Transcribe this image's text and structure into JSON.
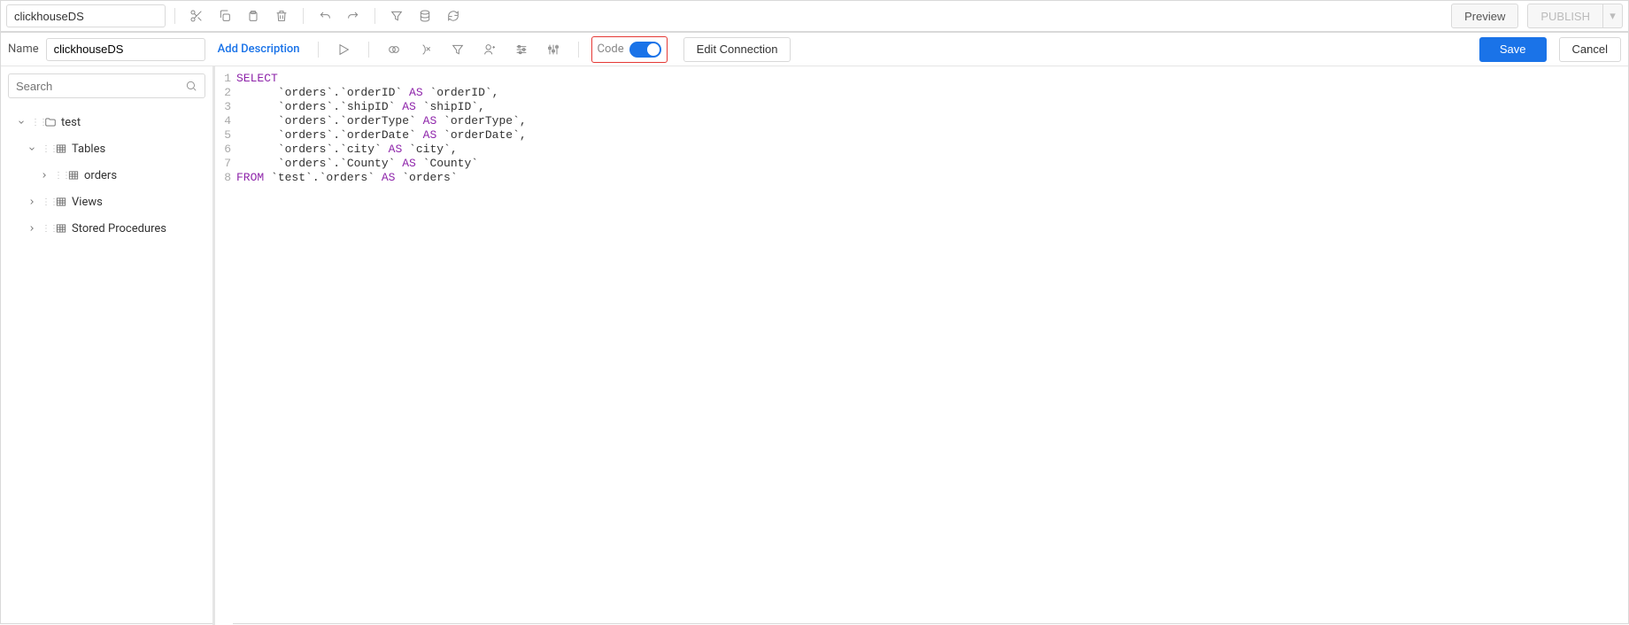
{
  "topToolbar": {
    "dataSourceName": "clickhouseDS",
    "previewLabel": "Preview",
    "publishLabel": "PUBLISH"
  },
  "secondToolbar": {
    "nameLabel": "Name",
    "nameValue": "clickhouseDS",
    "addDescription": "Add Description",
    "codeLabel": "Code",
    "editConnectionLabel": "Edit Connection",
    "saveLabel": "Save",
    "cancelLabel": "Cancel"
  },
  "sidebar": {
    "searchPlaceholder": "Search",
    "nodes": {
      "test": "test",
      "tables": "Tables",
      "orders": "orders",
      "views": "Views",
      "storedProcedures": "Stored Procedures"
    }
  },
  "editor": {
    "lineNumbers": [
      "1",
      "2",
      "3",
      "4",
      "5",
      "6",
      "7",
      "8"
    ],
    "lines": [
      [
        {
          "t": "SELECT",
          "c": "kw"
        }
      ],
      [
        {
          "t": "      `orders`.`orderID` ",
          "c": "id"
        },
        {
          "t": "AS",
          "c": "kw"
        },
        {
          "t": " `orderID`,",
          "c": "id"
        }
      ],
      [
        {
          "t": "      `orders`.`shipID` ",
          "c": "id"
        },
        {
          "t": "AS",
          "c": "kw"
        },
        {
          "t": " `shipID`,",
          "c": "id"
        }
      ],
      [
        {
          "t": "      `orders`.`orderType` ",
          "c": "id"
        },
        {
          "t": "AS",
          "c": "kw"
        },
        {
          "t": " `orderType`,",
          "c": "id"
        }
      ],
      [
        {
          "t": "      `orders`.`orderDate` ",
          "c": "id"
        },
        {
          "t": "AS",
          "c": "kw"
        },
        {
          "t": " `orderDate`,",
          "c": "id"
        }
      ],
      [
        {
          "t": "      `orders`.`city` ",
          "c": "id"
        },
        {
          "t": "AS",
          "c": "kw"
        },
        {
          "t": " `city`,",
          "c": "id"
        }
      ],
      [
        {
          "t": "      `orders`.`County` ",
          "c": "id"
        },
        {
          "t": "AS",
          "c": "kw"
        },
        {
          "t": " `County`",
          "c": "id"
        }
      ],
      [
        {
          "t": "FROM",
          "c": "kw"
        },
        {
          "t": " `test`.`orders` ",
          "c": "id"
        },
        {
          "t": "AS",
          "c": "kw"
        },
        {
          "t": " `orders`",
          "c": "id"
        }
      ]
    ]
  }
}
